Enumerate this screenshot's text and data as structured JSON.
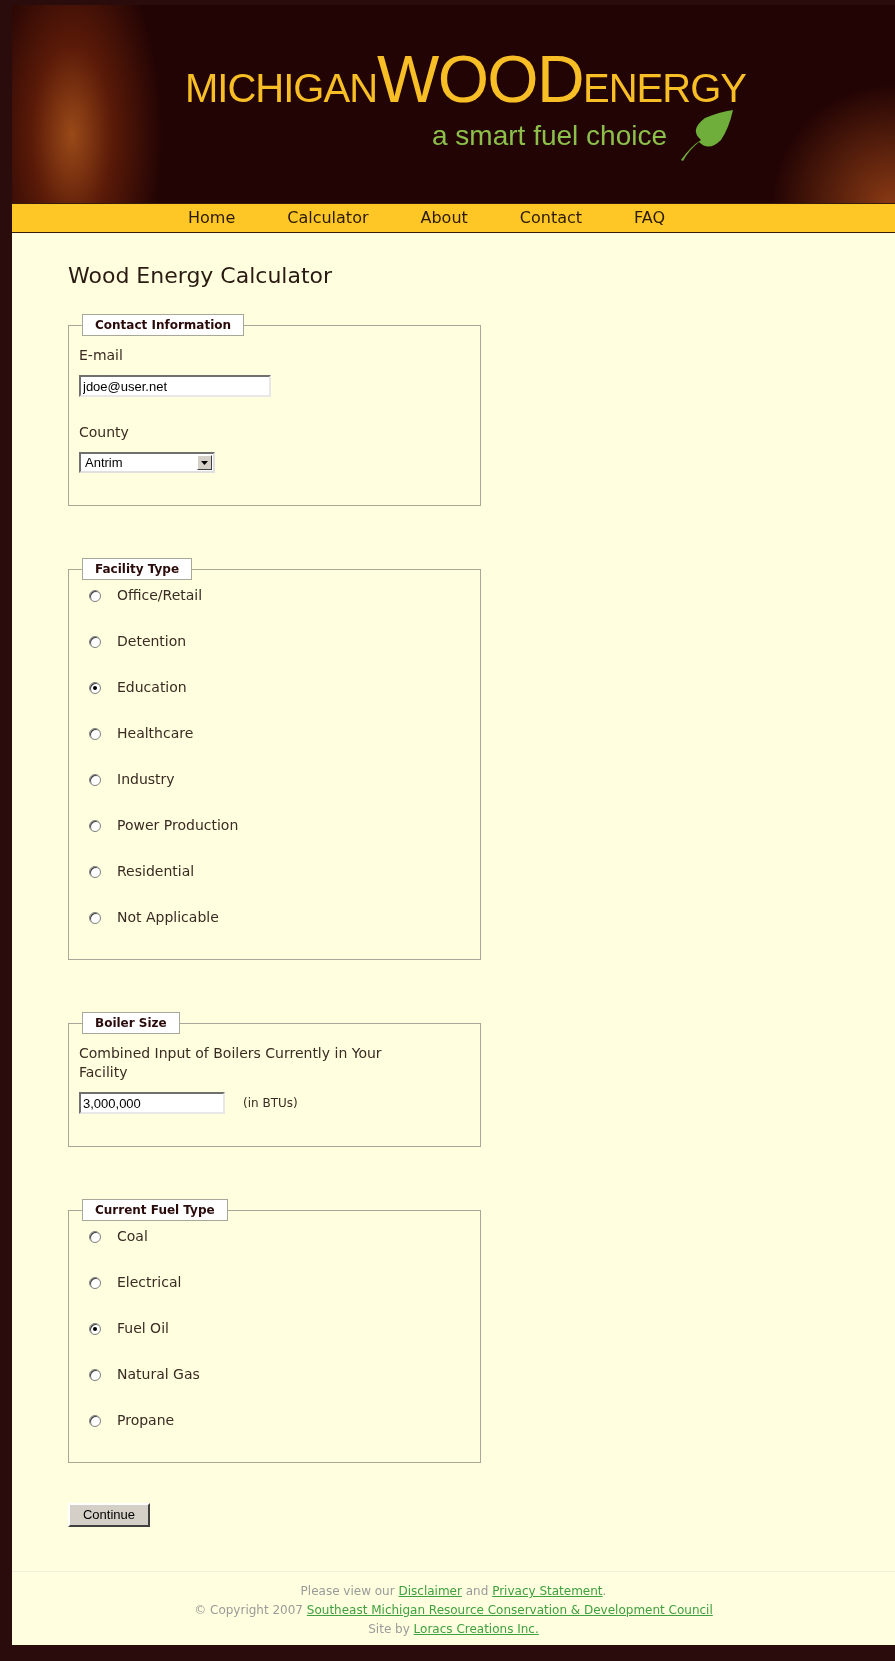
{
  "header": {
    "logo": [
      {
        "text": "MICHIGAN",
        "kind": "small"
      },
      {
        "text": "WOOD",
        "kind": "large"
      },
      {
        "text": "ENERGY",
        "kind": "small"
      }
    ],
    "tagline": "a smart fuel choice"
  },
  "nav": [
    "Home",
    "Calculator",
    "About",
    "Contact",
    "FAQ"
  ],
  "title": "Wood Energy Calculator",
  "sections": [
    {
      "kind": "fields",
      "legend": "Contact Information",
      "fields": [
        {
          "kind": "text",
          "label": "E-mail",
          "value": "jdoe@user.net"
        },
        {
          "kind": "select",
          "label": "County",
          "value": "Antrim"
        }
      ]
    },
    {
      "kind": "radios",
      "legend": "Facility Type",
      "options": [
        {
          "label": "Office/Retail",
          "selected": false
        },
        {
          "label": "Detention",
          "selected": false
        },
        {
          "label": "Education",
          "selected": true
        },
        {
          "label": "Healthcare",
          "selected": false
        },
        {
          "label": "Industry",
          "selected": false
        },
        {
          "label": "Power Production",
          "selected": false
        },
        {
          "label": "Residential",
          "selected": false
        },
        {
          "label": "Not Applicable",
          "selected": false
        }
      ]
    },
    {
      "kind": "fields",
      "legend": "Boiler Size",
      "fields": [
        {
          "kind": "text",
          "label": "Combined Input of Boilers Currently in Your Facility",
          "value": "3,000,000",
          "unit": "(in BTUs)"
        }
      ]
    },
    {
      "kind": "radios",
      "legend": "Current Fuel Type",
      "options": [
        {
          "label": "Coal",
          "selected": false
        },
        {
          "label": "Electrical",
          "selected": false
        },
        {
          "label": "Fuel Oil",
          "selected": true
        },
        {
          "label": "Natural Gas",
          "selected": false
        },
        {
          "label": "Propane",
          "selected": false
        }
      ]
    }
  ],
  "continue_button": "Continue",
  "footer": [
    [
      {
        "text": "Please view our "
      },
      {
        "text": "Disclaimer",
        "link": true
      },
      {
        "text": " and "
      },
      {
        "text": "Privacy Statement",
        "link": true
      },
      {
        "text": "."
      }
    ],
    [
      {
        "text": "© Copyright 2007 "
      },
      {
        "text": "Southeast Michigan Resource Conservation & Development Council",
        "link": true
      }
    ],
    [
      {
        "text": "Site by "
      },
      {
        "text": "Loracs Creations Inc.",
        "link": true
      }
    ]
  ]
}
